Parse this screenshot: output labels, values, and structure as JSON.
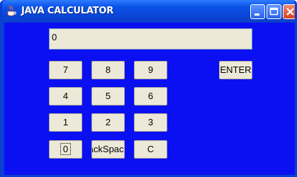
{
  "window": {
    "title": "JAVA CALCULATOR",
    "icon": "java-cup-icon",
    "controls": [
      "minimize-icon",
      "maximize-icon",
      "close-icon"
    ]
  },
  "display": {
    "value": "0"
  },
  "buttons": {
    "seven": "7",
    "eight": "8",
    "nine": "9",
    "four": "4",
    "five": "5",
    "six": "6",
    "one": "1",
    "two": "2",
    "three": "3",
    "zero": "0",
    "backspace": "BackSpace",
    "clear": "C",
    "enter": "ENTER"
  },
  "colors": {
    "background": "#0b10f2",
    "button": "#ece9d8",
    "titlebar": "#0a45d6"
  }
}
